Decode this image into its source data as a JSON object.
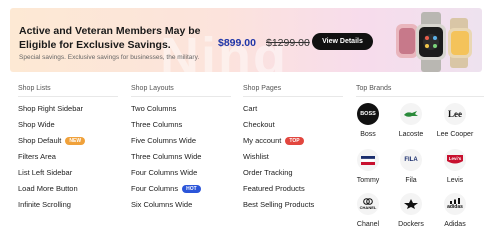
{
  "promo": {
    "title": "Active and Veteran Members May be Eligible for Exclusive Savings.",
    "subtitle": "Special savings. Exclusive savings for businesses, the military.",
    "price_new": "$899.00",
    "price_old": "$1299.00",
    "button_label": "View Details",
    "watermark": "Ning"
  },
  "columns": [
    {
      "title": "Shop Lists",
      "items": [
        {
          "label": "Shop Right Sidebar",
          "badge": ""
        },
        {
          "label": "Shop Wide",
          "badge": ""
        },
        {
          "label": "Shop Default",
          "badge": "NEW"
        },
        {
          "label": "Filters Area",
          "badge": ""
        },
        {
          "label": "List Left Sidebar",
          "badge": ""
        },
        {
          "label": "Load More Button",
          "badge": ""
        },
        {
          "label": "Infinite Scrolling",
          "badge": ""
        }
      ]
    },
    {
      "title": "Shop Layouts",
      "items": [
        {
          "label": "Two Columns",
          "badge": ""
        },
        {
          "label": "Three Columns",
          "badge": ""
        },
        {
          "label": "Five Columns Wide",
          "badge": ""
        },
        {
          "label": "Three Columns Wide",
          "badge": ""
        },
        {
          "label": "Four Columns Wide",
          "badge": ""
        },
        {
          "label": "Four Columns",
          "badge": "HOT"
        },
        {
          "label": "Six Columns Wide",
          "badge": ""
        }
      ]
    },
    {
      "title": "Shop Pages",
      "items": [
        {
          "label": "Cart",
          "badge": ""
        },
        {
          "label": "Checkout",
          "badge": ""
        },
        {
          "label": "My account",
          "badge": "TOP"
        },
        {
          "label": "Wishlist",
          "badge": ""
        },
        {
          "label": "Order Tracking",
          "badge": ""
        },
        {
          "label": "Featured Products",
          "badge": ""
        },
        {
          "label": "Best Selling Products",
          "badge": ""
        }
      ]
    }
  ],
  "badge_colors": {
    "NEW": "#f0a13a",
    "HOT": "#2b55d9",
    "TOP": "#e2463e"
  },
  "brands": {
    "title": "Top Brands",
    "items": [
      {
        "name": "Boss",
        "logo_text": "BOSS",
        "icon": "boss-logo-icon"
      },
      {
        "name": "Lacoste",
        "logo_text": "",
        "icon": "lacoste-logo-icon"
      },
      {
        "name": "Lee Cooper",
        "logo_text": "Lee",
        "icon": "lee-logo-icon"
      },
      {
        "name": "Tommy",
        "logo_text": "",
        "icon": "tommy-logo-icon"
      },
      {
        "name": "Fila",
        "logo_text": "FILA",
        "icon": "fila-logo-icon"
      },
      {
        "name": "Levis",
        "logo_text": "Levi's",
        "icon": "levis-logo-icon"
      },
      {
        "name": "Chanel",
        "logo_text": "CHANEL",
        "icon": "chanel-logo-icon"
      },
      {
        "name": "Dockers",
        "logo_text": "",
        "icon": "dockers-logo-icon"
      },
      {
        "name": "Adidas",
        "logo_text": "adidas",
        "icon": "adidas-logo-icon"
      }
    ]
  }
}
